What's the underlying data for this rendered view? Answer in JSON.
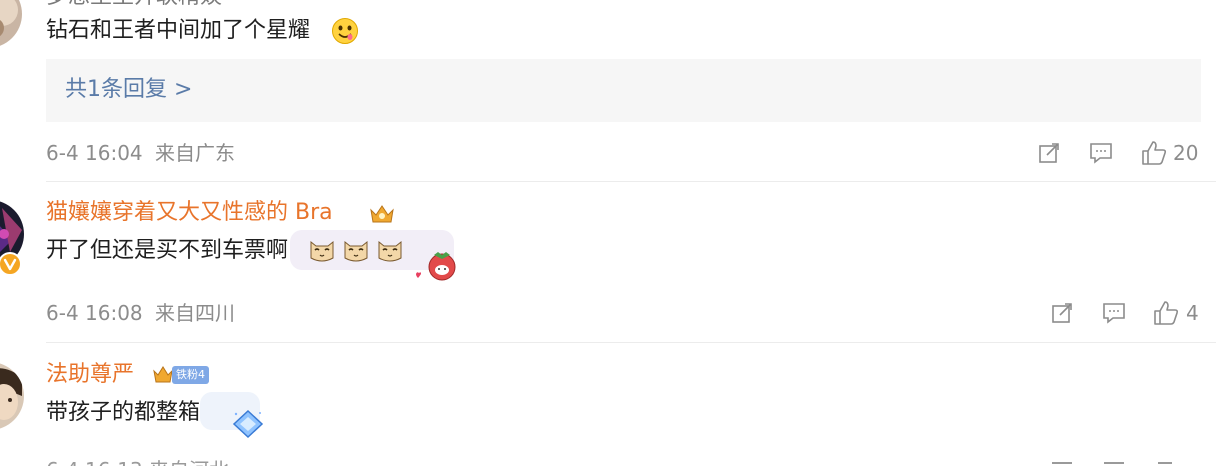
{
  "comments": [
    {
      "username_partial": "",
      "text": "钻石和王者中间加了个星耀",
      "reply_summary": "共1条回复 >",
      "time": "6-4 16:04",
      "location": "来自广东",
      "likes": "20"
    },
    {
      "username": "猫孃孃穿着又大又性感的 Bra",
      "text": "开了但还是买不到车票啊",
      "time": "6-4 16:08",
      "location": "来自四川",
      "likes": "4"
    },
    {
      "username": "法助尊严",
      "fan_badge": "铁粉4",
      "text": "带孩子的都整箱",
      "time": "",
      "location": ""
    }
  ],
  "colors": {
    "username": "#e8742b",
    "link": "#5a7ba8",
    "meta": "#8c8c8c",
    "reply_bg": "#f6f6f6"
  },
  "icons": [
    "share-icon",
    "comment-icon",
    "like-icon",
    "verified-badge-icon",
    "vip-crown-icon"
  ]
}
